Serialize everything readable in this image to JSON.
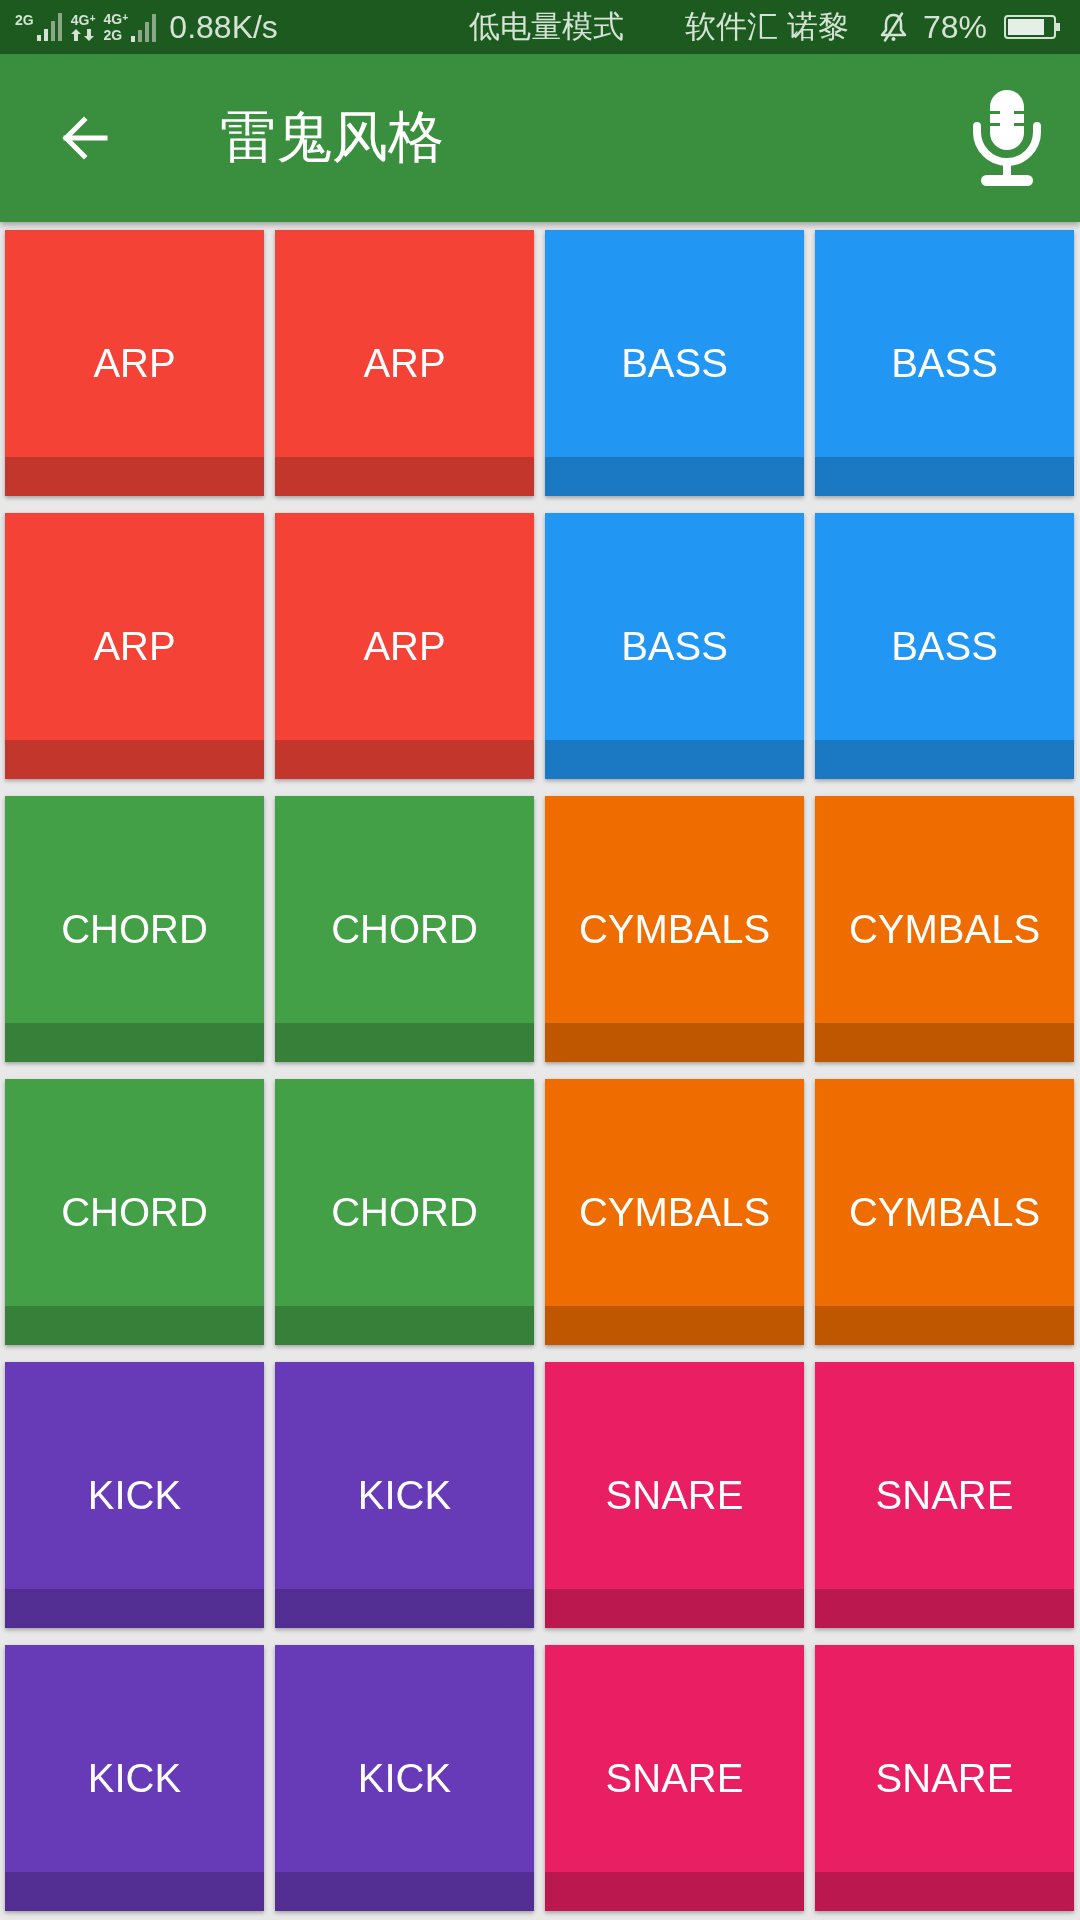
{
  "status_bar": {
    "sim_1": {
      "network": "2G"
    },
    "data_indicator": {
      "network": "4G$^{+}$"
    },
    "sim_2": {
      "networks": [
        "4G$^{+}$",
        "2G"
      ]
    },
    "net_speed": "0.88K/s",
    "power_mode": "低电量模式",
    "carrier": "软件汇 诺黎",
    "battery": "78%"
  },
  "app_bar": {
    "title": "雷鬼风格"
  },
  "pads": [
    {
      "label": "ARP",
      "color": "#f44336"
    },
    {
      "label": "ARP",
      "color": "#f44336"
    },
    {
      "label": "BASS",
      "color": "#2196f3"
    },
    {
      "label": "BASS",
      "color": "#2196f3"
    },
    {
      "label": "ARP",
      "color": "#f44336"
    },
    {
      "label": "ARP",
      "color": "#f44336"
    },
    {
      "label": "BASS",
      "color": "#2196f3"
    },
    {
      "label": "BASS",
      "color": "#2196f3"
    },
    {
      "label": "CHORD",
      "color": "#43a047"
    },
    {
      "label": "CHORD",
      "color": "#43a047"
    },
    {
      "label": "CYMBALS",
      "color": "#ef6c00"
    },
    {
      "label": "CYMBALS",
      "color": "#ef6c00"
    },
    {
      "label": "CHORD",
      "color": "#43a047"
    },
    {
      "label": "CHORD",
      "color": "#43a047"
    },
    {
      "label": "CYMBALS",
      "color": "#ef6c00"
    },
    {
      "label": "CYMBALS",
      "color": "#ef6c00"
    },
    {
      "label": "KICK",
      "color": "#673ab7"
    },
    {
      "label": "KICK",
      "color": "#673ab7"
    },
    {
      "label": "SNARE",
      "color": "#e91e63"
    },
    {
      "label": "SNARE",
      "color": "#e91e63"
    },
    {
      "label": "KICK",
      "color": "#673ab7"
    },
    {
      "label": "KICK",
      "color": "#673ab7"
    },
    {
      "label": "SNARE",
      "color": "#e91e63"
    },
    {
      "label": "SNARE",
      "color": "#e91e63"
    }
  ]
}
